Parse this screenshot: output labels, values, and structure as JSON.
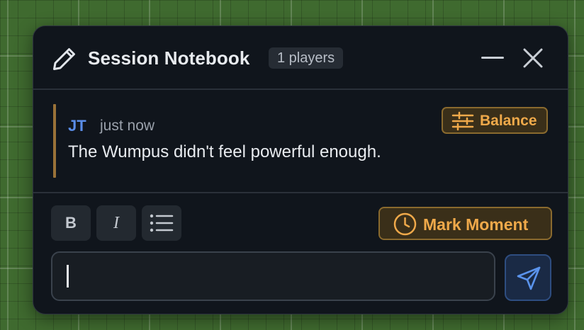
{
  "notebook": {
    "title": "Session Notebook",
    "players_badge": "1 players",
    "icons": {
      "title": "pencil-icon",
      "minimize": "minimize-icon",
      "close": "close-icon"
    }
  },
  "messages": [
    {
      "author": "JT",
      "timestamp": "just now",
      "text": "The Wumpus didn't feel powerful enough.",
      "tag": {
        "label": "Balance",
        "icon": "sliders-icon"
      }
    }
  ],
  "composer": {
    "format_buttons": {
      "bold": "B",
      "italic": "I",
      "list_icon": "list-icon"
    },
    "mark_moment_label": "Mark Moment",
    "mark_moment_icon": "clock-icon",
    "input_value": "",
    "send_icon": "send-icon"
  },
  "colors": {
    "panel_bg": "#10151c",
    "accent_orange": "#efa94a",
    "author_blue": "#5a8de8",
    "quote_bar": "#9a7238",
    "text_primary": "#e8ebef",
    "text_muted": "#9aa1ab"
  }
}
